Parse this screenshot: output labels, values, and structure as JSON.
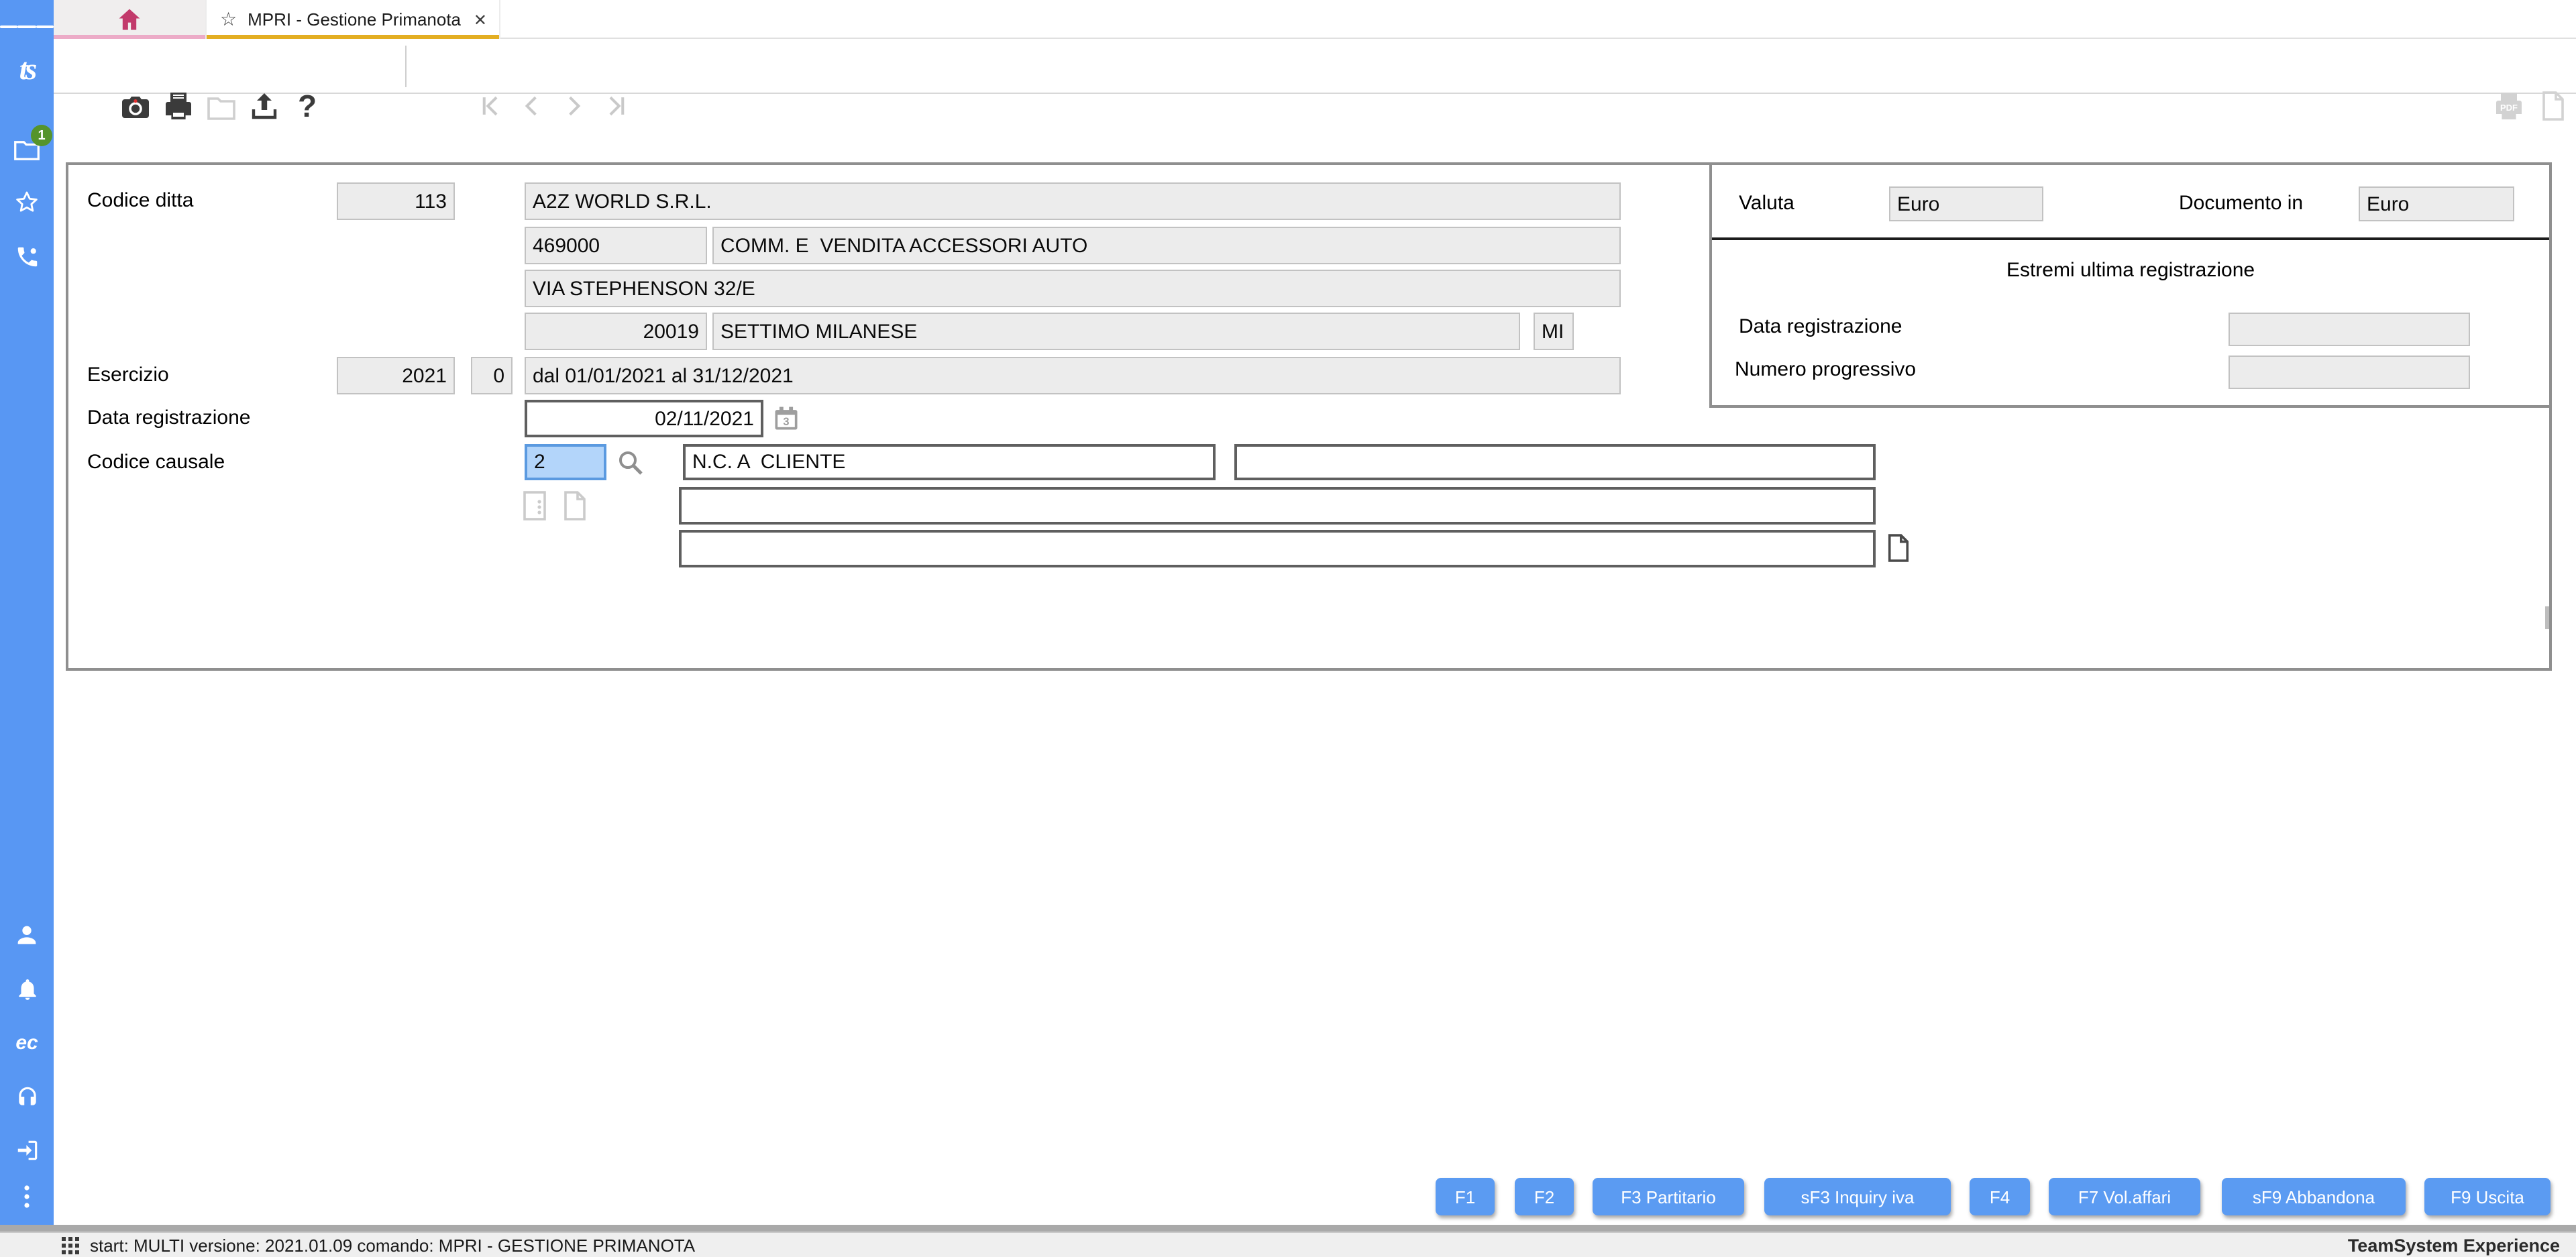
{
  "sidebar": {
    "badge_count": "1",
    "logo_text": "ts",
    "ec_label": "ec",
    "icons": [
      "menu-icon",
      "teamsystem-logo",
      "folder-icon",
      "star-icon",
      "phone-icon",
      "user-icon",
      "bell-icon",
      "ec-logo",
      "headset-icon",
      "exit-icon",
      "more-dots-icon"
    ]
  },
  "tabs": {
    "active": {
      "title": "MPRI - Gestione Primanota"
    }
  },
  "toolbar": {
    "icons": [
      "camera-icon",
      "print-icon",
      "folder-icon",
      "upload-icon",
      "help-icon",
      "nav-first",
      "nav-prev",
      "nav-next",
      "nav-last",
      "pdf-print-icon",
      "document-icon",
      "edit-pencil-icon"
    ],
    "help_glyph": "?"
  },
  "form": {
    "labels": {
      "codice_ditta": "Codice ditta",
      "esercizio": "Esercizio",
      "data_registrazione": "Data registrazione",
      "codice_causale": "Codice causale"
    },
    "company": {
      "code": "113",
      "name": "A2Z WORLD S.R.L.",
      "activity_code": "469000",
      "activity": "COMM. E  VENDITA ACCESSORI AUTO",
      "address": "VIA STEPHENSON 32/E",
      "cap": "20019",
      "city": "SETTIMO MILANESE",
      "province": "MI"
    },
    "esercizio": {
      "year": "2021",
      "sub": "0",
      "period": "dal 01/01/2021 al 31/12/2021"
    },
    "data_registrazione": "02/11/2021",
    "causale": {
      "code": "2",
      "description": "N.C. A  CLIENTE"
    }
  },
  "panel": {
    "valuta_label": "Valuta",
    "valuta_value": "Euro",
    "documento_in_label": "Documento in",
    "documento_in_value": "Euro",
    "section_title": "Estremi ultima registrazione",
    "data_registrazione_label": "Data registrazione",
    "numero_progressivo_label": "Numero progressivo"
  },
  "function_keys": [
    "F1",
    "F2",
    "F3 Partitario",
    "sF3 Inquiry iva",
    "F4",
    "F7 Vol.affari",
    "sF9 Abbandona",
    "F9 Uscita"
  ],
  "status_bar": {
    "text": "start: MULTI versione: 2021.01.09 comando: MPRI - GESTIONE PRIMANOTA",
    "brand": "TeamSystem Experience"
  },
  "colors": {
    "sidebar_blue": "#5897f3",
    "button_blue": "#5b9bf2",
    "active_tab_underline": "#e3ae22",
    "home_tab_underline": "#ecabc7",
    "home_icon": "#c23a6b",
    "badge_green": "#55942c",
    "causale_field_bg": "#b3d5fa",
    "field_gray": "#ececec"
  }
}
